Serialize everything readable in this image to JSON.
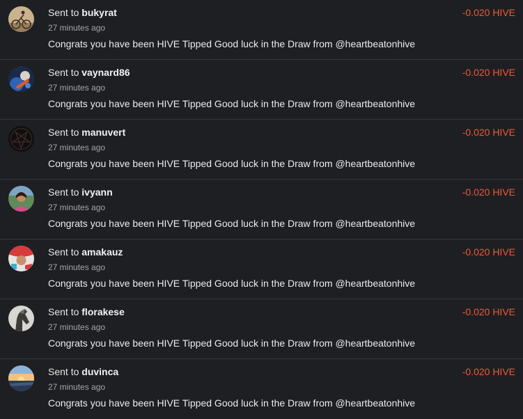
{
  "transfers": [
    {
      "prefix": "Sent to",
      "user": "bukyrat",
      "time": "27 minutes ago",
      "memo": "Congrats you have been HIVE Tipped Good luck in the Draw from @heartbeatonhive",
      "amount": "-0.020 HIVE",
      "avatar_icon": "cyclist-photo-avatar"
    },
    {
      "prefix": "Sent to",
      "user": "vaynard86",
      "time": "27 minutes ago",
      "memo": "Congrats you have been HIVE Tipped Good luck in the Draw from @heartbeatonhive",
      "amount": "-0.020 HIVE",
      "avatar_icon": "blue-figure-avatar"
    },
    {
      "prefix": "Sent to",
      "user": "manuvert",
      "time": "27 minutes ago",
      "memo": "Congrats you have been HIVE Tipped Good luck in the Draw from @heartbeatonhive",
      "amount": "-0.020 HIVE",
      "avatar_icon": "pentagram-avatar"
    },
    {
      "prefix": "Sent to",
      "user": "ivyann",
      "time": "27 minutes ago",
      "memo": "Congrats you have been HIVE Tipped Good luck in the Draw from @heartbeatonhive",
      "amount": "-0.020 HIVE",
      "avatar_icon": "person-portrait-avatar"
    },
    {
      "prefix": "Sent to",
      "user": "amakauz",
      "time": "27 minutes ago",
      "memo": "Congrats you have been HIVE Tipped Good luck in the Draw from @heartbeatonhive",
      "amount": "-0.020 HIVE",
      "avatar_icon": "red-white-avatar"
    },
    {
      "prefix": "Sent to",
      "user": "florakese",
      "time": "27 minutes ago",
      "memo": "Congrats you have been HIVE Tipped Good luck in the Draw from @heartbeatonhive",
      "amount": "-0.020 HIVE",
      "avatar_icon": "horse-avatar"
    },
    {
      "prefix": "Sent to",
      "user": "duvinca",
      "time": "27 minutes ago",
      "memo": "Congrats you have been HIVE Tipped Good luck in the Draw from @heartbeatonhive",
      "amount": "-0.020 HIVE",
      "avatar_icon": "sunset-avatar"
    }
  ],
  "colors": {
    "background": "#1e1f22",
    "divider": "#34363a",
    "amount": "#ea5a37",
    "secondary_text": "#a4a6aa"
  }
}
